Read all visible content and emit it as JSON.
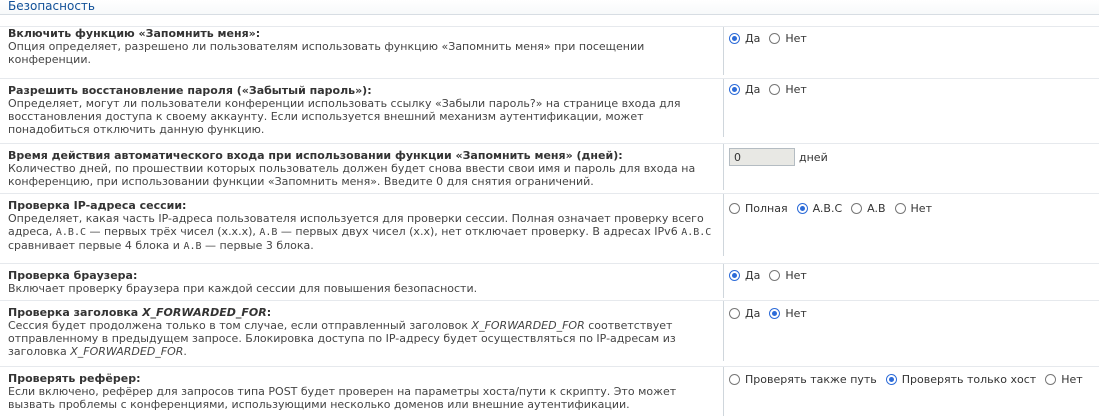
{
  "section": {
    "title": "Безопасность"
  },
  "rows": [
    {
      "title": "Включить функцию «Запомнить меня»:",
      "desc": "Опция определяет, разрешено ли пользователям использовать функцию «Запомнить меня» при посещении конференции.",
      "options": [
        "Да",
        "Нет"
      ],
      "selected": "Да"
    },
    {
      "title": "Разрешить восстановление пароля («Забытый пароль»):",
      "desc": "Определяет, могут ли пользователи конференции использовать ссылку «Забыли пароль?» на странице входа для восстановления доступа к своему аккаунту. Если используется внешний механизм аутентификации, может понадобиться отключить данную функцию.",
      "options": [
        "Да",
        "Нет"
      ],
      "selected": "Да"
    },
    {
      "title": "Время действия автоматического входа при использовании функции «Запомнить меня» (дней):",
      "desc": "Количество дней, по прошествии которых пользователь должен будет снова ввести свои имя и пароль для входа на конференцию, при использовании функции «Запомнить меня». Введите 0 для снятия ограничений.",
      "value": "0",
      "unit": "дней"
    },
    {
      "title": "Проверка IP-адреса сессии:",
      "desc_parts": {
        "p1": "Определяет, какая часть IP-адреса пользователя используется для проверки сессии. Полная означает проверку всего адреса, ",
        "c1": "A.B.C",
        "p2": " — первых трёх чисел (x.x.x), ",
        "c2": "A.B",
        "p3": " — первых двух чисел (x.x), нет отключает проверку. В адресах IPv6 ",
        "c3": "A.B.C",
        "p4": " сравнивает первые 4 блока и ",
        "c4": "A.B",
        "p5": " — первые 3 блока."
      },
      "options": [
        "Полная",
        "A.B.C",
        "A.B",
        "Нет"
      ],
      "selected": "A.B.C"
    },
    {
      "title": "Проверка браузера:",
      "desc": "Включает проверку браузера при каждой сессии для повышения безопасности.",
      "options": [
        "Да",
        "Нет"
      ],
      "selected": "Да"
    },
    {
      "title_parts": {
        "a": "Проверка заголовка ",
        "b": "X_FORWARDED_FOR",
        "c": ":"
      },
      "desc_parts": {
        "p1": "Сессия будет продолжена только в том случае, если отправленный заголовок ",
        "i1": "X_FORWARDED_FOR",
        "p2": " соответствует отправленному в предыдущем запросе. Блокировка доступа по IP-адресу будет осуществляться по IP-адресам из заголовка ",
        "i2": "X_FORWARDED_FOR",
        "p3": "."
      },
      "options": [
        "Да",
        "Нет"
      ],
      "selected": "Нет"
    },
    {
      "title": "Проверять рефёрер:",
      "desc": "Если включено, рефёрер для запросов типа POST будет проверен на параметры хоста/пути к скрипту. Это может вызвать проблемы с конференциями, использующими несколько доменов или внешние аутентификации.",
      "options": [
        "Проверять также путь",
        "Проверять только хост",
        "Нет"
      ],
      "selected": "Проверять только хост"
    }
  ]
}
